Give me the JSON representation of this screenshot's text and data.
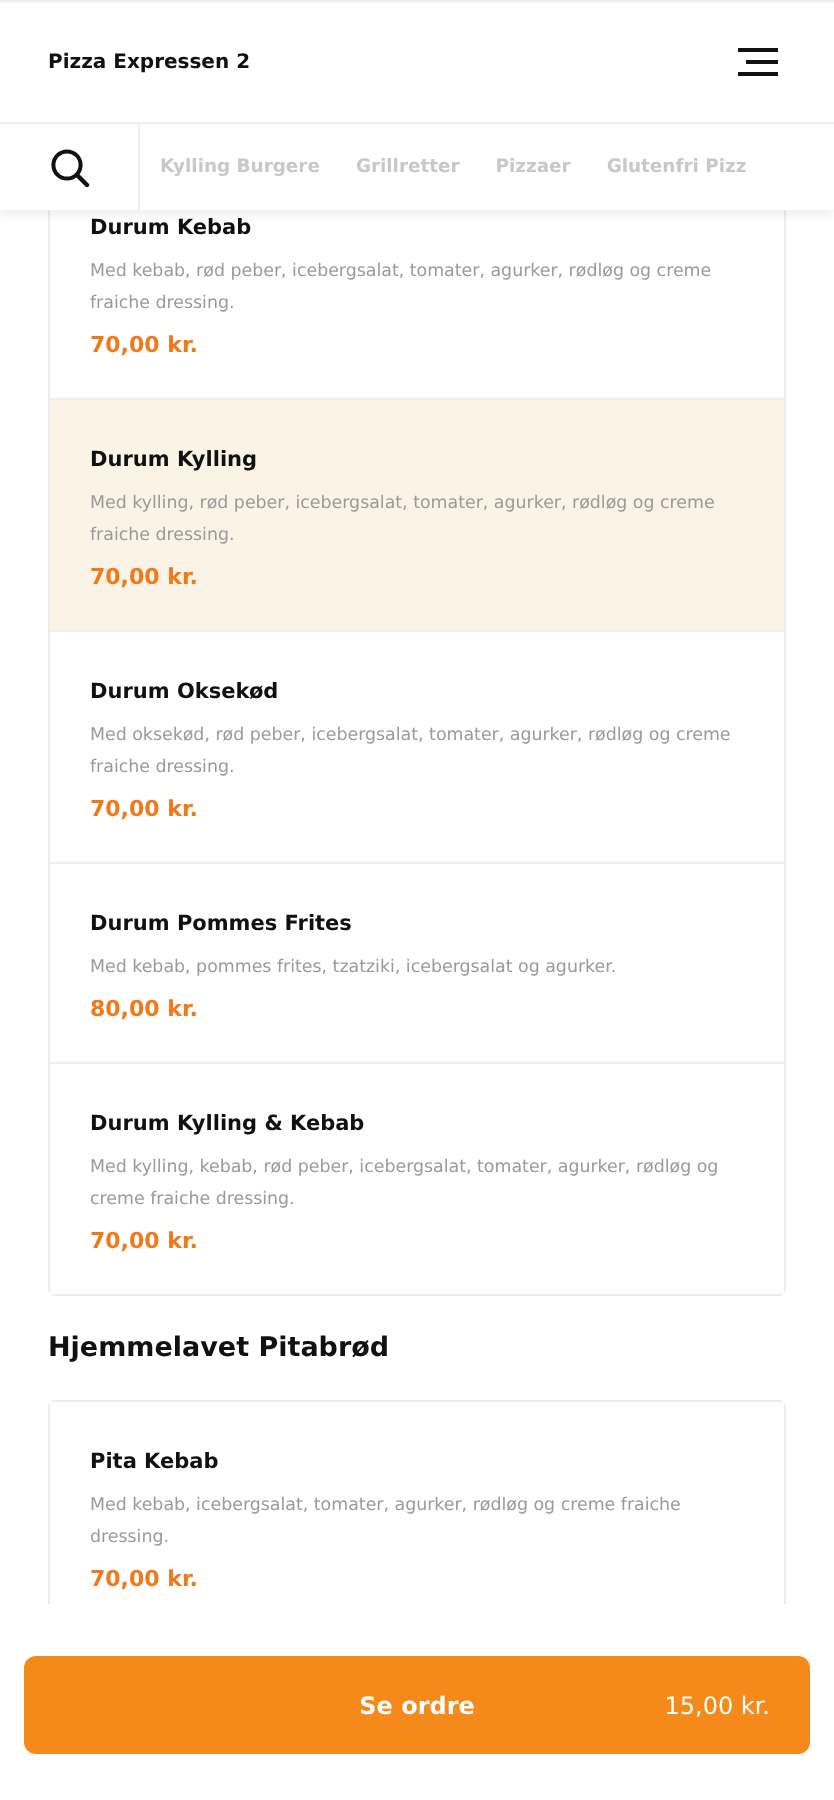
{
  "header": {
    "title": "Pizza Expressen 2"
  },
  "categories": [
    {
      "label": "Kylling Burgere",
      "selected": false
    },
    {
      "label": "Grillretter",
      "selected": false
    },
    {
      "label": "Pizzaer",
      "selected": false
    },
    {
      "label": "Glutenfri Pizz",
      "selected": false
    }
  ],
  "sections": [
    {
      "items": [
        {
          "name": "Durum Kebab",
          "description": "Med kebab, rød peber, icebergsalat, tomater, agurker, rødløg og creme fraiche dressing.",
          "price": "70,00 kr.",
          "highlighted": false
        },
        {
          "name": "Durum Kylling",
          "description": "Med kylling, rød peber, icebergsalat, tomater, agurker, rødløg og creme fraiche dressing.",
          "price": "70,00 kr.",
          "highlighted": true
        },
        {
          "name": "Durum Oksekød",
          "description": "Med oksekød, rød peber, icebergsalat, tomater, agurker, rødløg og creme fraiche dressing.",
          "price": "70,00 kr.",
          "highlighted": false
        },
        {
          "name": "Durum Pommes Frites",
          "description": "Med kebab, pommes frites, tzatziki, icebergsalat og agurker.",
          "price": "80,00 kr.",
          "highlighted": false
        },
        {
          "name": "Durum Kylling & Kebab",
          "description": "Med kylling, kebab, rød peber, icebergsalat, tomater, agurker, rødløg og creme fraiche dressing.",
          "price": "70,00 kr.",
          "highlighted": false
        }
      ]
    },
    {
      "title": "Hjemmelavet Pitabrød",
      "items": [
        {
          "name": "Pita Kebab",
          "description": "Med kebab, icebergsalat, tomater, agurker, rødløg og creme fraiche dressing.",
          "price": "70,00 kr.",
          "highlighted": false
        }
      ]
    }
  ],
  "order_button": {
    "label": "Se ordre",
    "total": "15,00 kr."
  }
}
